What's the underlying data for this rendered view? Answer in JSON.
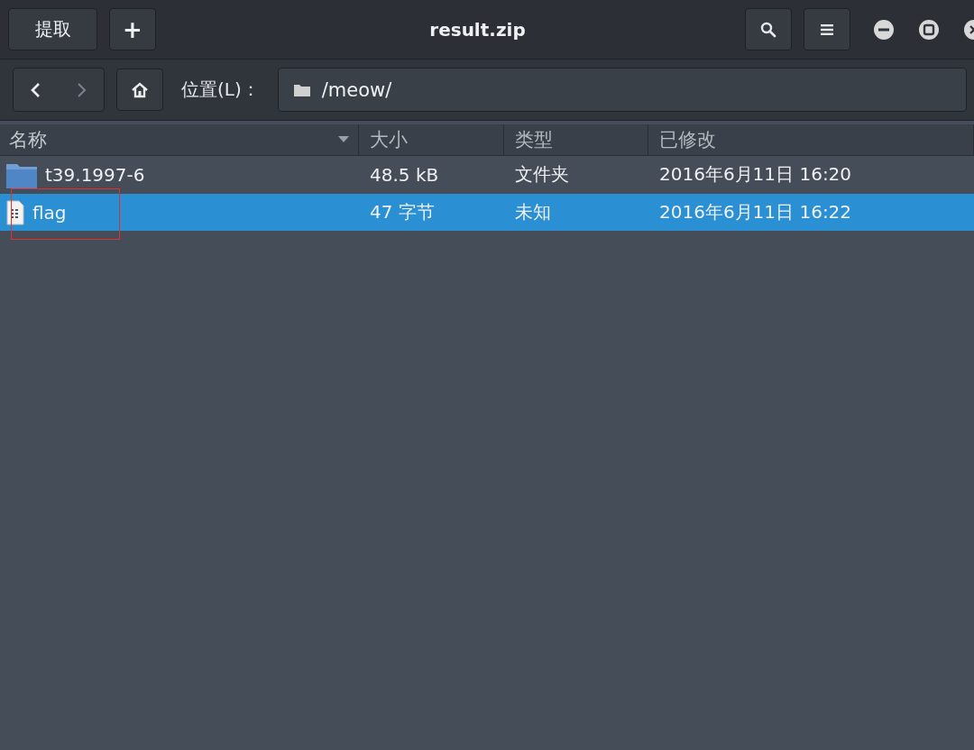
{
  "window": {
    "title": "result.zip"
  },
  "header_buttons": {
    "extract": "提取",
    "add": "+"
  },
  "location": {
    "label": "位置(L)：",
    "path": "/meow/"
  },
  "table": {
    "columns": [
      {
        "label": "名称",
        "sorted": true
      },
      {
        "label": "大小",
        "sorted": false
      },
      {
        "label": "类型",
        "sorted": false
      },
      {
        "label": "已修改",
        "sorted": false
      }
    ],
    "rows": [
      {
        "kind": "folder",
        "name": "t39.1997-6",
        "size": "48.5 kB",
        "type": "文件夹",
        "modified": "2016年6月11日 16:20",
        "selected": false,
        "annotated": false
      },
      {
        "kind": "file",
        "name": "flag",
        "size": "47 字节",
        "type": "未知",
        "modified": "2016年6月11日 16:22",
        "selected": true,
        "annotated": true
      }
    ]
  }
}
